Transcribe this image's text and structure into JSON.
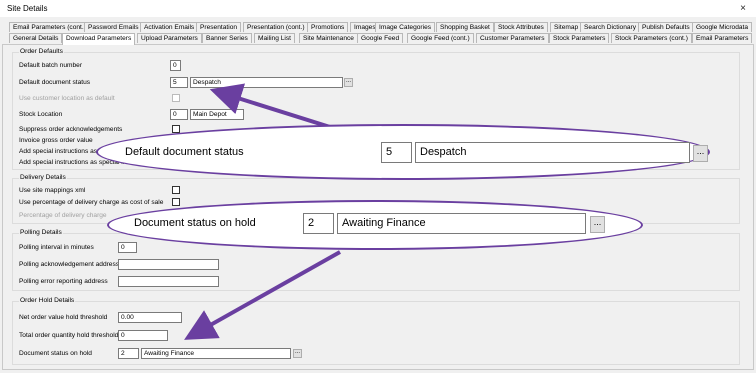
{
  "window": {
    "title": "Site Details",
    "close_glyph": "×"
  },
  "tabs_row1": [
    "Email Parameters (cont.)",
    "Password Emails",
    "Activation Emails",
    "Presentation",
    "Presentation (cont.)",
    "Promotions",
    "Images",
    "Image Categories",
    "Shopping Basket",
    "Stock Attributes",
    "Sitemap",
    "Search Dictionary",
    "Publish Defaults",
    "Google Microdata"
  ],
  "tabs_row2": [
    "General Details",
    "Download Parameters",
    "Upload Parameters",
    "Banner Series",
    "Mailing List",
    "Site Maintenance",
    "Google Feed",
    "Google Feed (cont.)",
    "Customer Parameters",
    "Stock Parameters",
    "Stock Parameters (cont.)",
    "Email Parameters"
  ],
  "active_tab": "Download Parameters",
  "order_defaults": {
    "legend": "Order Defaults",
    "default_batch_label": "Default batch number",
    "default_batch_value": "0",
    "doc_status_label": "Default document status",
    "doc_status_code": "5",
    "doc_status_name": "Despatch",
    "use_customer_location_label": "Use customer location as default",
    "stock_location_label": "Stock Location",
    "stock_location_code": "0",
    "stock_location_name": "Main Depot",
    "suppress_ack_label": "Suppress order acknowledgements",
    "invoice_gross_label": "Invoice gross order value",
    "special_instr_1_label": "Add special instructions as add",
    "special_instr_2_label": "Add special instructions as special ins"
  },
  "delivery_details": {
    "legend": "Delivery Details",
    "site_mappings_label": "Use site mappings xml",
    "pct_cost_label": "Use percentage of delivery charge as cost of sale",
    "pct_charge_label": "Percentage of delivery charge"
  },
  "polling_details": {
    "legend": "Polling Details",
    "interval_label": "Polling interval in minutes",
    "interval_value": "0",
    "ack_address_label": "Polling acknowledgement address",
    "error_address_label": "Polling error reporting address"
  },
  "order_hold": {
    "legend": "Order Hold Details",
    "net_value_label": "Net order value hold threshold",
    "net_value_value": "0.00",
    "qty_label": "Total order quantity hold threshold",
    "qty_value": "0",
    "doc_status_hold_label": "Document status on hold",
    "doc_status_hold_code": "2",
    "doc_status_hold_name": "Awaiting Finance"
  },
  "ellipsis": "...",
  "colors": {
    "annotation": "#6a3fa0"
  }
}
